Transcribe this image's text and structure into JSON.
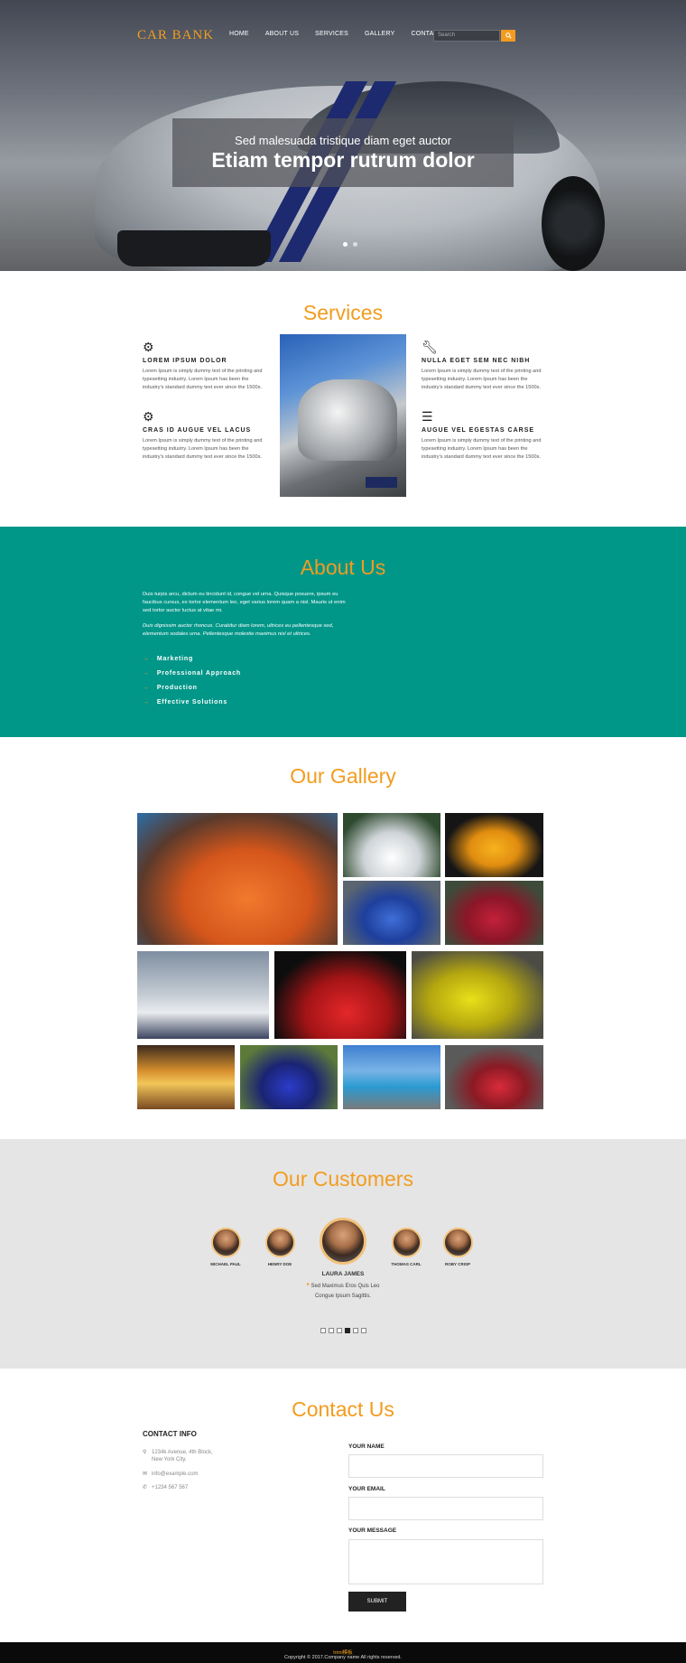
{
  "nav": {
    "logo": "CAR BANK",
    "items": [
      "HOME",
      "ABOUT US",
      "SERVICES",
      "GALLERY",
      "CONTACT"
    ],
    "search_placeholder": "Search"
  },
  "hero": {
    "subtitle": "Sed malesuada tristique diam eget auctor",
    "title": "Etiam tempor rutrum dolor"
  },
  "services": {
    "title": "Services",
    "items": [
      {
        "icon": "gear-icon",
        "heading": "LOREM IPSUM DOLOR",
        "text": "Lorem Ipsum is simply dummy text of the printing and typesetting industry. Lorem Ipsum has been the industry's standard dummy text ever since the 1500s."
      },
      {
        "icon": "gears-icon",
        "heading": "CRAS ID AUGUE VEL LACUS",
        "text": "Lorem Ipsum is simply dummy text of the printing and typesetting industry. Lorem Ipsum has been the industry's standard dummy text ever since the 1500s."
      },
      {
        "icon": "wrench-icon",
        "heading": "NULLA EGET SEM NEC NIBH",
        "text": "Lorem Ipsum is simply dummy text of the printing and typesetting industry. Lorem Ipsum has been the industry's standard dummy text ever since the 1500s."
      },
      {
        "icon": "server-icon",
        "heading": "AUGUE VEL EGESTAS CARSE",
        "text": "Lorem Ipsum is simply dummy text of the printing and typesetting industry. Lorem Ipsum has been the industry's standard dummy text ever since the 1500s."
      }
    ]
  },
  "about": {
    "title": "About Us",
    "para1": "Duis turpis arcu, dictum eu tincidunt id, congue vel urna. Quisque posuere, ipsum eu faucibus cursus, ex tortor elementum leo, eget varius lorem quam a nisl. Mauris ut enim sed tortor auctor luctus at vitae mi.",
    "para2": "Duis dignissim auctor rhoncus. Curabitur diam lorem, ultrices eu pellentesque sed, elementum sodales urna. Pellentesque molestie maximus nisl et ultrices.",
    "list": [
      "Marketing",
      "Professional Approach",
      "Production",
      "Effective Solutions"
    ]
  },
  "gallery": {
    "title": "Our Gallery"
  },
  "customers": {
    "title": "Our Customers",
    "names": [
      "MICHAEL PAUL",
      "HENRY DOE",
      "LAURA JAMES",
      "THOMAS CARL",
      "ROBY CRISP"
    ],
    "quote_line1": "Sed Maximus Eros Quis Leo",
    "quote_line2": "Congue Ipsum Sagittis."
  },
  "contact": {
    "title": "Contact Us",
    "info_title": "CONTACT INFO",
    "address_line1": "1234k Avenue, 4th Block,",
    "address_line2": "New York City.",
    "email": "info@example.com",
    "phone": "+1234 567 567",
    "name_label": "YOUR NAME",
    "email_label": "YOUR EMAIL",
    "message_label": "YOUR MESSAGE",
    "submit_label": "SUBMIT"
  },
  "footer": {
    "copyright": "Copyright © 2017.Company name All rights reserved.",
    "link": "html模板"
  },
  "colors": {
    "accent": "#f29c1f",
    "about_bg": "#009688",
    "customers_bg": "#e5e5e5",
    "footer_bg": "#0a0a0a"
  }
}
